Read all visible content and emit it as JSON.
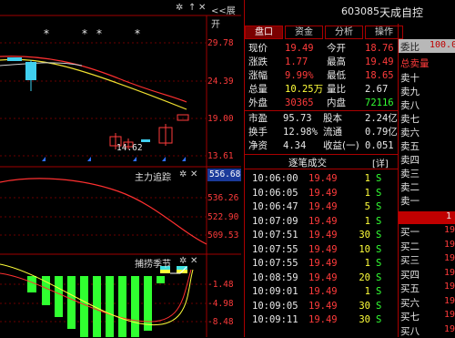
{
  "chart": {
    "toolbar": {
      "gear1": "✲",
      "arrow_up": "↑",
      "x1": "✕",
      "collapse": "<<展开"
    },
    "y_labels": [
      "29.78",
      "24.39",
      "19.00",
      "13.61"
    ],
    "low_marker": "14.62",
    "indicator1": {
      "title": "主力追踪",
      "value": "556.68",
      "ticks": [
        "536.26",
        "522.90",
        "509.53"
      ]
    },
    "indicator2": {
      "title": "捕捞季节",
      "ticks": [
        "-1.48",
        "-4.98",
        "-8.48"
      ]
    },
    "star": "*"
  },
  "panel": {
    "code": "603085",
    "name": "天成自控",
    "tabs": [
      "盘口",
      "资金",
      "分析",
      "操作"
    ],
    "quote": [
      {
        "l1": "现价",
        "v1": "19.49",
        "c1": "red",
        "l2": "今开",
        "v2": "18.76",
        "c2": "red"
      },
      {
        "l1": "涨跌",
        "v1": "1.77",
        "c1": "red",
        "l2": "最高",
        "v2": "19.49",
        "c2": "red"
      },
      {
        "l1": "涨幅",
        "v1": "9.99%",
        "c1": "red",
        "l2": "最低",
        "v2": "18.65",
        "c2": "red"
      },
      {
        "l1": "总量",
        "v1": "10.25万",
        "c1": "yel",
        "l2": "量比",
        "v2": "2.67",
        "c2": "wht"
      },
      {
        "l1": "外盘",
        "v1": "30365",
        "c1": "red",
        "l2": "内盘",
        "v2": "72116",
        "c2": "grn"
      }
    ],
    "stats": [
      {
        "l1": "市盈",
        "v1": "95.73",
        "c1": "wht",
        "l2": "股本",
        "v2": "2.24亿",
        "c2": "wht"
      },
      {
        "l1": "换手",
        "v1": "12.98%",
        "c1": "wht",
        "l2": "流通",
        "v2": "0.79亿",
        "c2": "wht"
      },
      {
        "l1": "净资",
        "v1": "4.34",
        "c1": "wht",
        "l2": "收益(一)",
        "v2": "0.051",
        "c2": "wht"
      }
    ],
    "trade_header": "逐笔成交",
    "trade_detail": "[详]",
    "trades": [
      {
        "time": "10:06:00",
        "price": "19.49",
        "vol": "1",
        "dir": "S"
      },
      {
        "time": "10:06:05",
        "price": "19.49",
        "vol": "1",
        "dir": "S"
      },
      {
        "time": "10:06:47",
        "price": "19.49",
        "vol": "5",
        "dir": "S"
      },
      {
        "time": "10:07:09",
        "price": "19.49",
        "vol": "1",
        "dir": "S"
      },
      {
        "time": "10:07:51",
        "price": "19.49",
        "vol": "30",
        "dir": "S"
      },
      {
        "time": "10:07:55",
        "price": "19.49",
        "vol": "10",
        "dir": "S"
      },
      {
        "time": "10:07:55",
        "price": "19.49",
        "vol": "1",
        "dir": "S"
      },
      {
        "time": "10:08:59",
        "price": "19.49",
        "vol": "20",
        "dir": "S"
      },
      {
        "time": "10:09:01",
        "price": "19.49",
        "vol": "1",
        "dir": "S"
      },
      {
        "time": "10:09:05",
        "price": "19.49",
        "vol": "30",
        "dir": "S"
      },
      {
        "time": "10:09:11",
        "price": "19.49",
        "vol": "30",
        "dir": "S"
      }
    ],
    "side": {
      "top_label": "委比",
      "top_value": "100.00",
      "sell_header": "总卖量",
      "sells": [
        "卖十",
        "卖九",
        "卖八",
        "卖七",
        "卖六",
        "卖五",
        "卖四",
        "卖三",
        "卖二",
        "卖一"
      ],
      "buy_highlight": "1",
      "buys": [
        "买一",
        "买二",
        "买三",
        "买四",
        "买五",
        "买六",
        "买七",
        "买八"
      ],
      "buy_values": [
        "19",
        "19",
        "19",
        "19",
        "19",
        "19",
        "19",
        "19"
      ]
    }
  },
  "colors": {
    "up": "#ff3b3b",
    "down": "#33ff33",
    "grid": "#a00000",
    "accent_yellow": "#ffff3a"
  }
}
